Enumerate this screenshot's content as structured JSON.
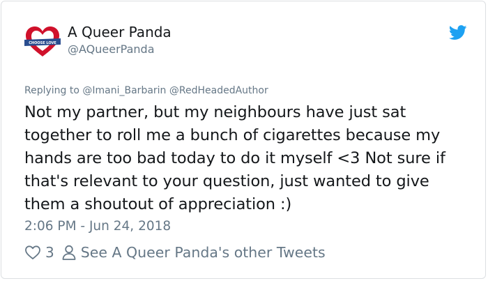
{
  "tweet": {
    "author": {
      "display_name": "A Queer Panda",
      "handle": "@AQueerPanda",
      "avatar_icon": "heart-banner-logo-icon",
      "avatar_banner_text": "CHOOSE LOVE"
    },
    "platform_icon": "twitter-bird-icon",
    "reply": {
      "prefix": "Replying to",
      "mention_1": "@Imani_Barbarin",
      "mention_2": "@RedHeadedAuthor"
    },
    "text": "Not my partner, but my neighbours have just sat together to roll me a bunch of cigarettes because my hands are too bad today to do it myself <3 Not sure if that's relevant to your question, just wanted to give them a shoutout of appreciation :)",
    "timestamp": "2:06 PM - Jun 24, 2018",
    "actions": {
      "like_icon": "heart-outline-icon",
      "like_count": "3",
      "profile_icon": "person-icon",
      "other_tweets_label": "See A Queer Panda's other Tweets"
    }
  },
  "colors": {
    "text_primary": "#14171a",
    "text_secondary": "#657786",
    "twitter_blue": "#1da1f2",
    "avatar_red": "#d0112b",
    "border": "#dcdfe2"
  }
}
